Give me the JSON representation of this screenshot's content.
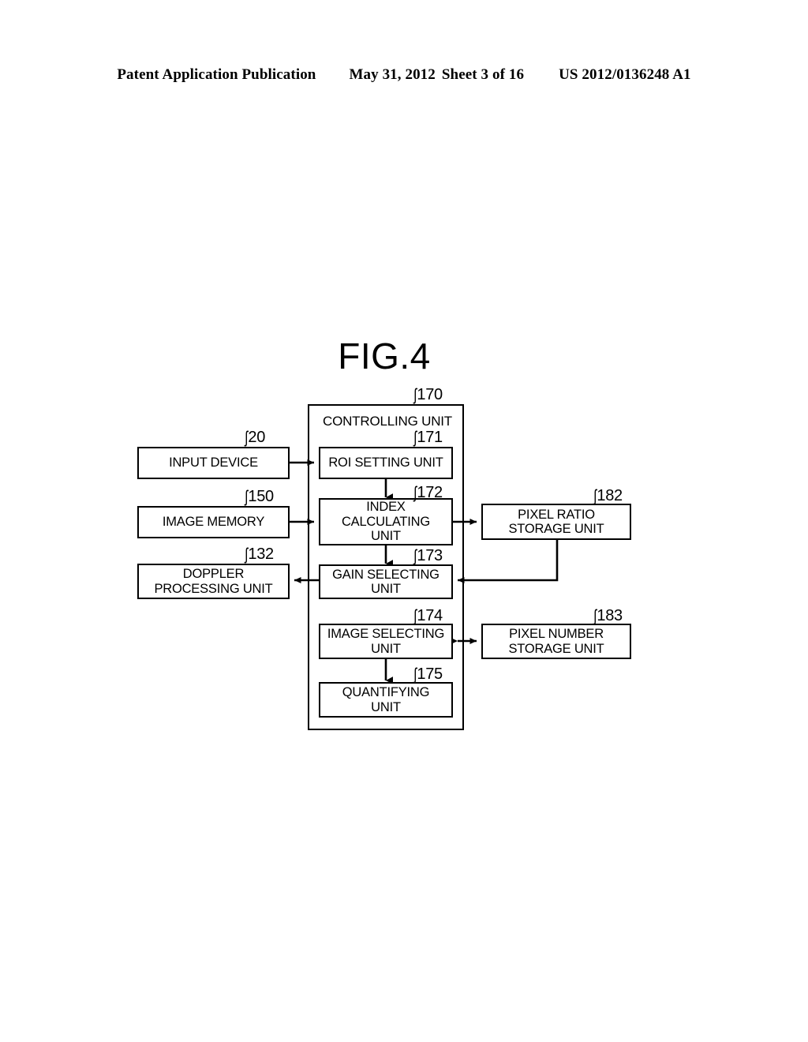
{
  "header": {
    "publication": "Patent Application Publication",
    "date": "May 31, 2012",
    "sheet": "Sheet 3 of 16",
    "number": "US 2012/0136248 A1"
  },
  "figure": {
    "title": "FIG.4"
  },
  "diagram": {
    "nodes": [
      {
        "id": "controlling",
        "label": "CONTROLLING UNIT",
        "ref": "170"
      },
      {
        "id": "input-device",
        "label": "INPUT DEVICE",
        "ref": "20"
      },
      {
        "id": "image-memory",
        "label": "IMAGE MEMORY",
        "ref": "150"
      },
      {
        "id": "doppler",
        "label": "DOPPLER\nPROCESSING UNIT",
        "ref": "132"
      },
      {
        "id": "roi-setting",
        "label": "ROI SETTING UNIT",
        "ref": "171"
      },
      {
        "id": "index-calc",
        "label": "INDEX\nCALCULATING\nUNIT",
        "ref": "172"
      },
      {
        "id": "gain-selecting",
        "label": "GAIN SELECTING\nUNIT",
        "ref": "173"
      },
      {
        "id": "image-selecting",
        "label": "IMAGE SELECTING\nUNIT",
        "ref": "174"
      },
      {
        "id": "quantifying",
        "label": "QUANTIFYING\nUNIT",
        "ref": "175"
      },
      {
        "id": "pixel-ratio",
        "label": "PIXEL RATIO\nSTORAGE UNIT",
        "ref": "182"
      },
      {
        "id": "pixel-number",
        "label": "PIXEL NUMBER\nSTORAGE UNIT",
        "ref": "183"
      }
    ],
    "ref_marker": "Ʃ",
    "connections": [
      {
        "from": "input-device",
        "to": "roi-setting",
        "type": "single"
      },
      {
        "from": "image-memory",
        "to": "index-calc",
        "type": "single"
      },
      {
        "from": "roi-setting",
        "to": "index-calc",
        "type": "single"
      },
      {
        "from": "index-calc",
        "to": "gain-selecting",
        "type": "single"
      },
      {
        "from": "index-calc",
        "to": "pixel-ratio",
        "type": "single"
      },
      {
        "from": "pixel-ratio",
        "to": "gain-selecting",
        "type": "single"
      },
      {
        "from": "gain-selecting",
        "to": "doppler",
        "type": "single"
      },
      {
        "from": "image-selecting",
        "to": "pixel-number",
        "type": "double"
      },
      {
        "from": "image-selecting",
        "to": "quantifying",
        "type": "single"
      }
    ]
  },
  "colors": {
    "ink": "#000000",
    "paper": "#ffffff"
  }
}
